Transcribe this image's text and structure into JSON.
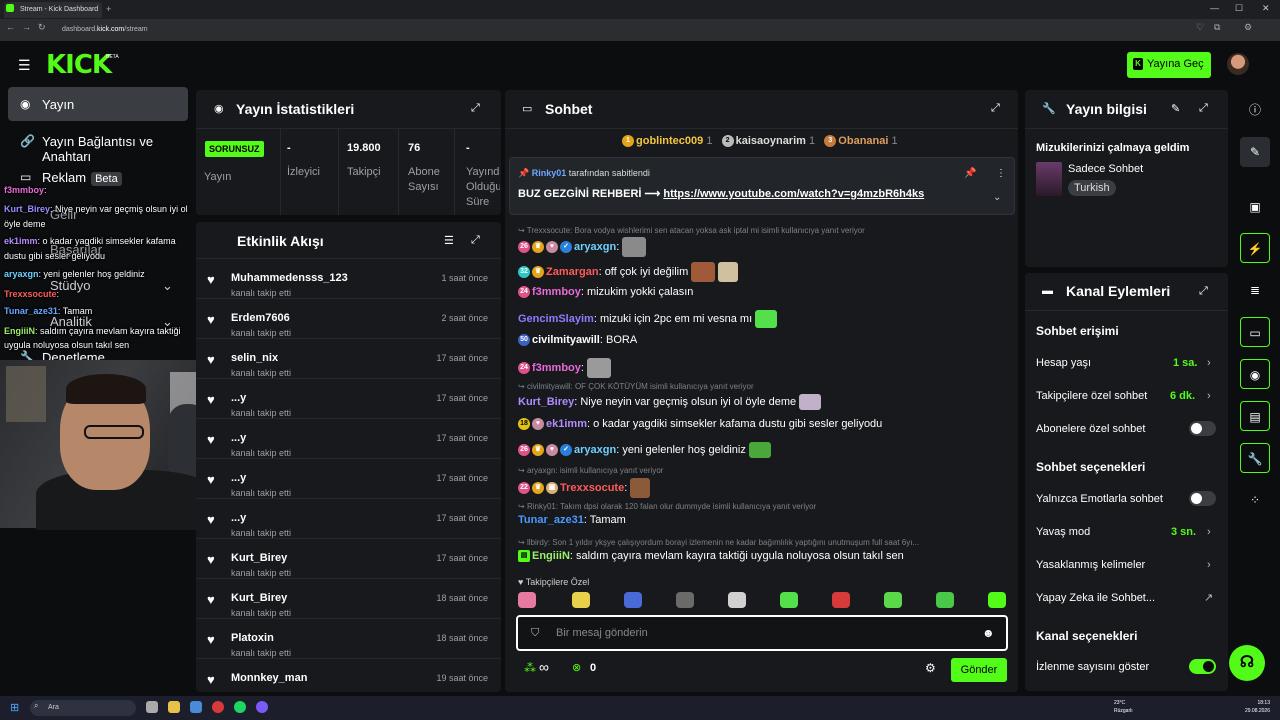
{
  "browser": {
    "tab_title": "Stream - Kick Dashboard",
    "url_prefix": "dashboard.",
    "url_host": "kick.com",
    "url_path": "/stream"
  },
  "header": {
    "logo": "KICK",
    "logo_badge": "BETA",
    "go_live_label": "Yayına Geç"
  },
  "sidebar": {
    "items": [
      {
        "label": "Yayın"
      },
      {
        "label": "Yayın Bağlantısı ve Anahtarı"
      },
      {
        "label": "Reklam",
        "badge": "Beta"
      },
      {
        "label": "Gelir"
      },
      {
        "label": "Başarılar"
      },
      {
        "label": "Stüdyo"
      },
      {
        "label": "Analitik"
      },
      {
        "label": "Denetleme"
      }
    ]
  },
  "overlay_chat": [
    {
      "user": "f3mmboy",
      "text": ":"
    },
    {
      "user": "Kurt_Birey",
      "text": ": Niye neyin var geçmiş olsun iyi ol"
    },
    {
      "user": "",
      "text": "öyle deme"
    },
    {
      "user": "ek1imm",
      "text": ": o kadar yagdiki simsekler kafama"
    },
    {
      "user": "",
      "text": "dustu gibi sesler geliyodu"
    },
    {
      "user": "aryaxgn",
      "text": ": yeni gelenler hoş geldiniz"
    },
    {
      "user": "Trexxsocute",
      "text": ":"
    },
    {
      "user": "Tunar_aze31",
      "text": ": Tamam"
    },
    {
      "user": "EngiiiN",
      "text": ": saldım çayıra mevlam kayıra taktiği"
    },
    {
      "user": "",
      "text": "uygula noluyosa olsun takıl sen"
    }
  ],
  "stats": {
    "title": "Yayın İstatistikleri",
    "status": "SORUNSUZ",
    "status_label": "Yayın",
    "viewers_value": "-",
    "viewers_label": "İzleyici",
    "followers_value": "19.800",
    "followers_label": "Takipçi",
    "subs_value": "76",
    "subs_label_1": "Abone",
    "subs_label_2": "Sayısı",
    "duration_value": "-",
    "duration_label_1": "Yayında",
    "duration_label_2": "Olduğu",
    "duration_label_3": "Süre"
  },
  "activity": {
    "title": "Etkinlik Akışı",
    "rows": [
      {
        "name": "Muhammedensss_123",
        "action": "kanalı takip etti",
        "time": "1 saat önce"
      },
      {
        "name": "Erdem7606",
        "action": "kanalı takip etti",
        "time": "2 saat önce"
      },
      {
        "name": "selin_nix",
        "action": "kanalı takip etti",
        "time": "17 saat önce"
      },
      {
        "name": "...y",
        "action": "kanalı takip etti",
        "time": "17 saat önce"
      },
      {
        "name": "...y",
        "action": "kanalı takip etti",
        "time": "17 saat önce"
      },
      {
        "name": "...y",
        "action": "kanalı takip etti",
        "time": "17 saat önce"
      },
      {
        "name": "...y",
        "action": "kanalı takip etti",
        "time": "17 saat önce"
      },
      {
        "name": "Kurt_Birey",
        "action": "kanalı takip etti",
        "time": "17 saat önce"
      },
      {
        "name": "Kurt_Birey",
        "action": "kanalı takip etti",
        "time": "18 saat önce"
      },
      {
        "name": "Platoxin",
        "action": "kanalı takip etti",
        "time": "18 saat önce"
      },
      {
        "name": "Monnkey_man",
        "action": "",
        "time": "19 saat önce"
      }
    ]
  },
  "chat": {
    "title": "Sohbet",
    "top_gifters": [
      {
        "name": "goblintec009",
        "count": "1"
      },
      {
        "name": "kaisaoynarim",
        "count": "1"
      },
      {
        "name": "Obananai",
        "count": "1"
      }
    ],
    "pinned": {
      "pinned_by": "Rinky01",
      "pinned_suffix": "tarafından sabitlendi",
      "text": "BUZ GEZGİNİ REHBERİ ⟶ ",
      "link": "https://www.youtube.com/watch?v=g4mzbR6h4ks"
    },
    "messages": [
      {
        "reply": "Trexxsocute: Bora vodya wishlerimi sen atacan yoksa ask iptal mi isimli kullanıcıya yanıt veriyor"
      },
      {
        "user": "aryaxgn",
        "text": ":"
      },
      {
        "user": "Zamargan",
        "text": ": off çok iyi değilim"
      },
      {
        "user": "f3mmboy",
        "text": ": mizukim yokki çalasın"
      },
      {
        "user": "GencimSlayim",
        "text": ": mizuki için 2pc em mi vesna mı"
      },
      {
        "user": "civilmityawill",
        "text": ": BORA"
      },
      {
        "user": "f3mmboy",
        "text": ":"
      },
      {
        "reply": "civilmityawill: OF ÇOK KÖTÜYÜM isimli kullanıcıya yanıt veriyor"
      },
      {
        "user": "Kurt_Birey",
        "text": ": Niye neyin var geçmiş olsun iyi ol öyle deme"
      },
      {
        "user": "ek1imm",
        "text": ": o kadar yagdiki simsekler kafama dustu gibi sesler geliyodu"
      },
      {
        "user": "aryaxgn",
        "text": ": yeni gelenler hoş geldiniz"
      },
      {
        "reply": "aryaxgn: isimli kullanıcıya yanıt veriyor"
      },
      {
        "user": "Trexxsocute",
        "text": ":"
      },
      {
        "reply": "Rinky01: Takım dpsi olarak 120 falan olur dummyde isimli kullanıcıya yanıt veriyor"
      },
      {
        "user": "Tunar_aze31",
        "text": ": Tamam"
      },
      {
        "reply": "llbirdy: Son 1 yıldır ykşye çalışıyordum borayi izlemenin ne kadar bağımlılık yaptığını unutmuşum full saat 6yı..."
      },
      {
        "user": "EngiiiN",
        "text": ": saldım çayıra mevlam kayıra taktiği uygula noluyosa olsun takıl sen"
      }
    ],
    "followers_only_label": "Takipçilere Özel",
    "input_placeholder": "Bir mesaj gönderin",
    "infinity": "∞",
    "points": "0",
    "send_label": "Gönder"
  },
  "stream_info": {
    "title": "Yayın bilgisi",
    "stream_title": "Mizukilerinizi çalmaya geldim",
    "category": "Sadece Sohbet",
    "language": "Turkish"
  },
  "channel_actions": {
    "title": "Kanal Eylemleri",
    "chat_access_title": "Sohbet erişimi",
    "account_age_label": "Hesap yaşı",
    "account_age_value": "1 sa.",
    "followers_chat_label": "Takipçilere özel sohbet",
    "followers_chat_value": "6 dk.",
    "subs_chat_label": "Abonelere özel sohbet",
    "chat_options_title": "Sohbet seçenekleri",
    "emote_only_label": "Yalnızca Emotlarla sohbet",
    "slow_mode_label": "Yavaş mod",
    "slow_mode_value": "3 sn.",
    "banned_words_label": "Yasaklanmış kelimeler",
    "ai_chat_label": "Yapay Zeka ile Sohbet...",
    "channel_options_title": "Kanal seçenekleri",
    "show_viewers_label": "İzlenme sayısını göster"
  },
  "taskbar": {
    "search_placeholder": "Ara",
    "temp": "23°C",
    "weather": "Rüzgarlı",
    "time": "18:13",
    "date": "29.08.2026"
  },
  "colors": {
    "accent": "#53fc18",
    "panel": "#17191c",
    "background": "#0b0d0f"
  }
}
